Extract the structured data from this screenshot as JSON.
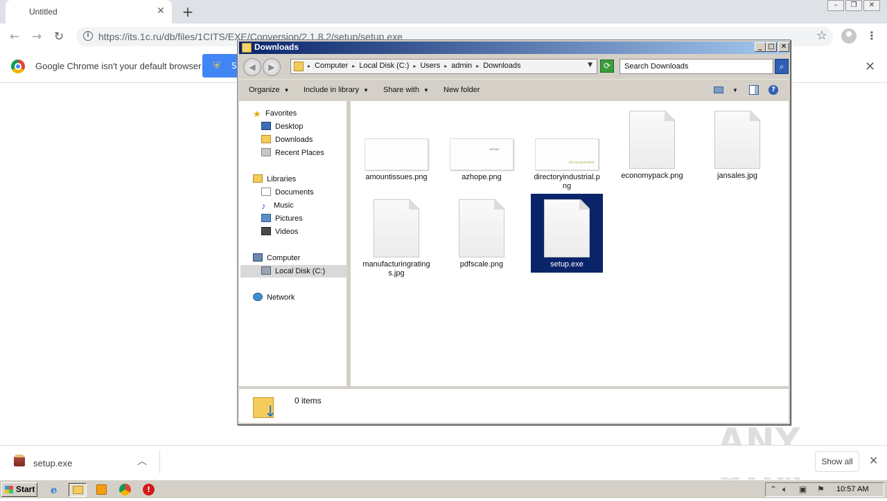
{
  "browser": {
    "tab_title": "Untitled",
    "url": "https://its.1c.ru/db/files/1CITS/EXE/Conversion/2.1.8.2/setup/setup.exe",
    "infobar_text": "Google Chrome isn't your default browser",
    "infobar_button_label": "S",
    "download_shelf": {
      "file_name": "setup.exe",
      "show_all_label": "Show all"
    }
  },
  "explorer": {
    "title": "Downloads",
    "breadcrumbs": [
      "Computer",
      "Local Disk (C:)",
      "Users",
      "admin",
      "Downloads"
    ],
    "search_placeholder": "Search Downloads",
    "commands": [
      "Organize",
      "Include in library",
      "Share with",
      "New folder"
    ],
    "nav": {
      "favorites": {
        "label": "Favorites",
        "items": [
          "Desktop",
          "Downloads",
          "Recent Places"
        ]
      },
      "libraries": {
        "label": "Libraries",
        "items": [
          "Documents",
          "Music",
          "Pictures",
          "Videos"
        ]
      },
      "computer": {
        "label": "Computer",
        "items": [
          "Local Disk (C:)"
        ]
      },
      "network": {
        "label": "Network"
      }
    },
    "files": [
      {
        "name": "amountissues.png",
        "thumb": "wide",
        "thumb_text": ""
      },
      {
        "name": "azhope.png",
        "thumb": "wide",
        "thumb_text": "azhope"
      },
      {
        "name": "directoryindustrial.png",
        "thumb": "wide",
        "thumb_text": "directoryindustrial"
      },
      {
        "name": "economypack.png",
        "thumb": "doc"
      },
      {
        "name": "jansales.jpg",
        "thumb": "doc"
      },
      {
        "name": "manufacturingratings.jpg",
        "thumb": "doc"
      },
      {
        "name": "pdfscale.png",
        "thumb": "doc"
      },
      {
        "name": "setup.exe",
        "thumb": "doc",
        "selected": true
      }
    ],
    "status": "0 items"
  },
  "watermark": "ANY RUN",
  "taskbar": {
    "start_label": "Start",
    "clock": "10:57 AM"
  },
  "colors": {
    "selection": "#0a246a",
    "title_gradient_start": "#0a246a",
    "chrome_blue": "#4285f4"
  }
}
